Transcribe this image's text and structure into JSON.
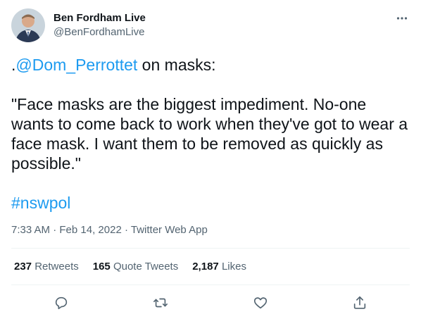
{
  "author": {
    "display_name": "Ben Fordham Live",
    "handle": "@BenFordhamLive"
  },
  "tweet": {
    "lead_prefix": ".",
    "mention": "@Dom_Perrottet",
    "lead_suffix": " on masks:",
    "quote": "\"Face masks are the biggest impediment. No-one wants to come back to work when they've got to wear a face mask. I want them to be removed as quickly as possible.\"",
    "hashtag": "#nswpol"
  },
  "meta": {
    "time": "7:33 AM",
    "sep1": " · ",
    "date": "Feb 14, 2022",
    "sep2": " · ",
    "app": "Twitter Web App"
  },
  "stats": {
    "retweets_count": "237",
    "retweets_label": "Retweets",
    "quotes_count": "165",
    "quotes_label": "Quote Tweets",
    "likes_count": "2,187",
    "likes_label": "Likes"
  },
  "colors": {
    "link": "#1d9bf0",
    "muted": "#536471",
    "text": "#0f1419",
    "divider": "#eff3f4"
  },
  "icons": [
    "more-icon",
    "reply-icon",
    "retweet-icon",
    "like-icon",
    "share-icon"
  ]
}
